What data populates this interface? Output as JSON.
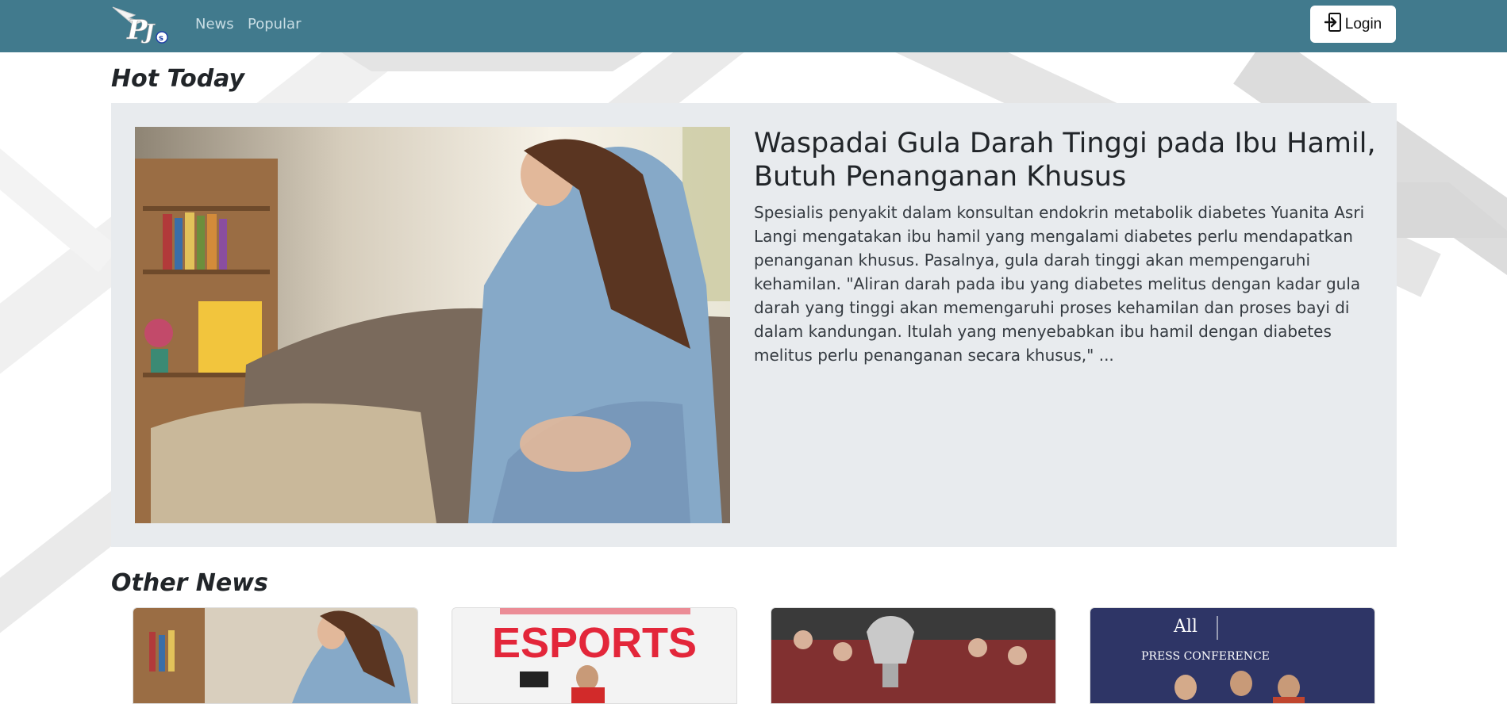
{
  "nav": {
    "items": [
      {
        "label": "News"
      },
      {
        "label": "Popular"
      }
    ],
    "login_label": "Login",
    "logo_text": "s"
  },
  "sections": {
    "hot_today": "Hot Today",
    "other_news": "Other News"
  },
  "hot_article": {
    "headline": "Waspadai Gula Darah Tinggi pada Ibu Hamil, Butuh Penanganan Khusus",
    "summary": "Spesialis penyakit dalam konsultan endokrin metabolik diabetes Yuanita Asri Langi mengatakan ibu hamil yang mengalami diabetes perlu mendapatkan penanganan khusus. Pasalnya, gula darah tinggi akan mempengaruhi kehamilan. \"Aliran darah pada ibu yang diabetes melitus dengan kadar gula darah yang tinggi akan memengaruhi proses kehamilan dan proses bayi di dalam kandungan. Itulah yang menyebabkan ibu hamil dengan diabetes melitus perlu penanganan secara khusus,\" ..."
  },
  "other_news": [
    {
      "thumb_text": ""
    },
    {
      "thumb_text": "ESPORTS"
    },
    {
      "thumb_text": ""
    },
    {
      "thumb_text": "PRESS CONFERENCE"
    }
  ],
  "colors": {
    "navbar": "#417a8d",
    "card_bg": "#e8ebee",
    "esports_red": "#e3263a"
  }
}
